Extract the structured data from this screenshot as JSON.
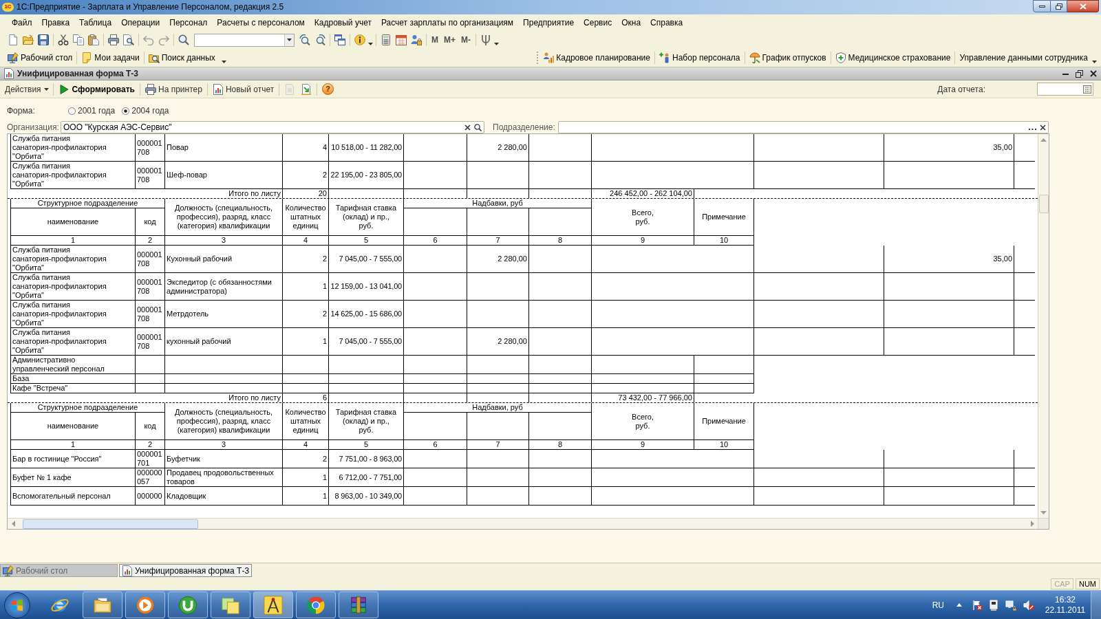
{
  "window": {
    "logo": "1С",
    "title": "1С:Предприятие - Зарплата и Управление Персоналом, редакция 2.5"
  },
  "menu": [
    "Файл",
    "Правка",
    "Таблица",
    "Операции",
    "Персонал",
    "Расчеты с персоналом",
    "Кадровый учет",
    "Расчет зарплаты по организациям",
    "Предприятие",
    "Сервис",
    "Окна",
    "Справка"
  ],
  "toolbar": {
    "memory_buttons": [
      "M",
      "M+",
      "M-"
    ]
  },
  "panel": {
    "left": [
      {
        "label": "Рабочий стол",
        "dropdown": false
      },
      {
        "label": "Мои задачи",
        "dropdown": false
      },
      {
        "label": "Поиск данных",
        "dropdown": true
      }
    ],
    "right": [
      {
        "label": "Кадровое планирование"
      },
      {
        "label": "Набор персонала"
      },
      {
        "label": "График отпусков"
      },
      {
        "label": "Медицинское страхование"
      },
      {
        "label": "Управление данными сотрудника"
      }
    ]
  },
  "document": {
    "title": "Унифицированная форма Т-3",
    "toolbar": {
      "actions": {
        "label": "Действия"
      },
      "generate": {
        "label": "Сформировать"
      },
      "buttons": [
        {
          "label": "На принтер"
        },
        {
          "label": "Новый отчет"
        }
      ],
      "icon_buttons": [
        {
          "disabled": true
        },
        {
          "disabled": false
        }
      ],
      "help": {
        "label": "?"
      }
    },
    "report_date": {
      "label": "Дата отчета:"
    }
  },
  "form": {
    "label": "Форма:",
    "options": [
      {
        "label": "2001 года",
        "selected": false
      },
      {
        "label": "2004 года",
        "selected": true
      }
    ]
  },
  "organization": {
    "label": "Организация:",
    "value": "ООО \"Курская АЭС-Сервис\""
  },
  "department": {
    "label": "Подразделение:"
  },
  "sheet": {
    "rows": [
      {
        "kind": "detail",
        "name": "Служба питания\nсанатория-профилактория\n\"Орбита\"",
        "code": "000001708",
        "position": "Повар",
        "count": "4",
        "rate": "10 518,00 - 11 282,00",
        "column_7": "2 280,00",
        "column_12": "35,00"
      },
      {
        "kind": "detail",
        "name": "Служба питания\nсанатория-профилактория\n\"Орбита\"",
        "code": "000001708",
        "position": "Шеф-повар",
        "count": "2",
        "rate": "22 195,00 - 23 805,00"
      },
      {
        "kind": "total",
        "label": "Итого по листу",
        "count": "20",
        "sum": "246 452,00 - 262 104,00"
      },
      {
        "kind": "header",
        "group": "Структурное подразделение",
        "name": "наименование",
        "code": "код",
        "position": "Должность (специальность, профессия), разряд, класс (категория) квалификации",
        "count": "Количество штатных единиц",
        "rate": "Тарифная ставка\n(оклад) и пр.,\nруб.",
        "allowances": "Надбавки, руб",
        "total": "Всего,\nруб.",
        "note": "Примечание",
        "numbers": [
          "1",
          "2",
          "3",
          "4",
          "5",
          "6",
          "7",
          "8",
          "9",
          "10"
        ]
      },
      {
        "kind": "detail",
        "name": "Служба питания\nсанатория-профилактория\n\"Орбита\"",
        "code": "000001708",
        "position": "Кухонный рабочий",
        "count": "2",
        "rate": "7 045,00 - 7 555,00",
        "column_7": "2 280,00",
        "column_12": "35,00"
      },
      {
        "kind": "detail",
        "name": "Служба питания\nсанатория-профилактория\n\"Орбита\"",
        "code": "000001708",
        "position": "Экспедитор (с обязанностями администратора)",
        "count": "1",
        "rate": "12 159,00 - 13 041,00"
      },
      {
        "kind": "detail",
        "name": "Служба питания\nсанатория-профилактория\n\"Орбита\"",
        "code": "000001708",
        "position": "Метрдотель",
        "count": "2",
        "rate": "14 625,00 - 15 686,00"
      },
      {
        "kind": "detail",
        "name": "Служба питания\nсанатория-профилактория\n\"Орбита\"",
        "code": "000001708",
        "position": "кухонный рабочий",
        "count": "1",
        "rate": "7 045,00 - 7 555,00",
        "column_7": "2 280,00"
      },
      {
        "kind": "plain",
        "name": "Административно\nуправленческий персонал"
      },
      {
        "kind": "plain",
        "name": "База"
      },
      {
        "kind": "plain",
        "name": "Кафе \"Встреча\""
      },
      {
        "kind": "total",
        "label": "Итого по листу",
        "count": "6",
        "sum": "73 432,00 - 77 966,00"
      },
      {
        "kind": "header",
        "group": "Структурное подразделение",
        "name": "наименование",
        "code": "код",
        "position": "Должность (специальность, профессия), разряд, класс (категория) квалификации",
        "count": "Количество штатных единиц",
        "rate": "Тарифная ставка\n(оклад) и пр.,\nруб.",
        "allowances": "Надбавки, руб",
        "total": "Всего,\nруб.",
        "note": "Примечание",
        "numbers": [
          "1",
          "2",
          "3",
          "4",
          "5",
          "6",
          "7",
          "8",
          "9",
          "10"
        ]
      },
      {
        "kind": "detail",
        "name": "Бар в гостинице \"Россия\"",
        "code": "000001701",
        "position": "Буфетчик",
        "count": "2",
        "rate": "7 751,00 - 8 963,00"
      },
      {
        "kind": "detail",
        "name": "Буфет № 1 кафе",
        "code": "000000057",
        "position": "Продавец продовольственных товаров",
        "count": "1",
        "rate": "6 712,00 - 7 751,00"
      },
      {
        "kind": "detail",
        "name": "Вспомогательный персонал",
        "code": "000000",
        "position": "Кладовщик",
        "count": "1",
        "rate": "8 963,00 - 10 349,00"
      }
    ]
  },
  "window_tabs": [
    {
      "label": "Рабочий стол",
      "selected": false
    },
    {
      "label": "Унифицированная форма Т-3",
      "selected": true
    }
  ],
  "status_bar": {
    "indicators": [
      {
        "label": "CAP",
        "on": false
      },
      {
        "label": "NUM",
        "on": true
      }
    ]
  },
  "taskbar": {
    "apps": [
      {
        "running": false,
        "selected": false
      },
      {
        "running": true,
        "selected": false
      },
      {
        "running": true,
        "selected": false
      },
      {
        "running": true,
        "selected": false
      },
      {
        "running": true,
        "selected": false
      },
      {
        "running": true,
        "selected": true
      },
      {
        "running": true,
        "selected": false
      },
      {
        "running": true,
        "selected": false
      }
    ],
    "language": "RU",
    "time": "16:32",
    "date": "22.11.2011"
  }
}
